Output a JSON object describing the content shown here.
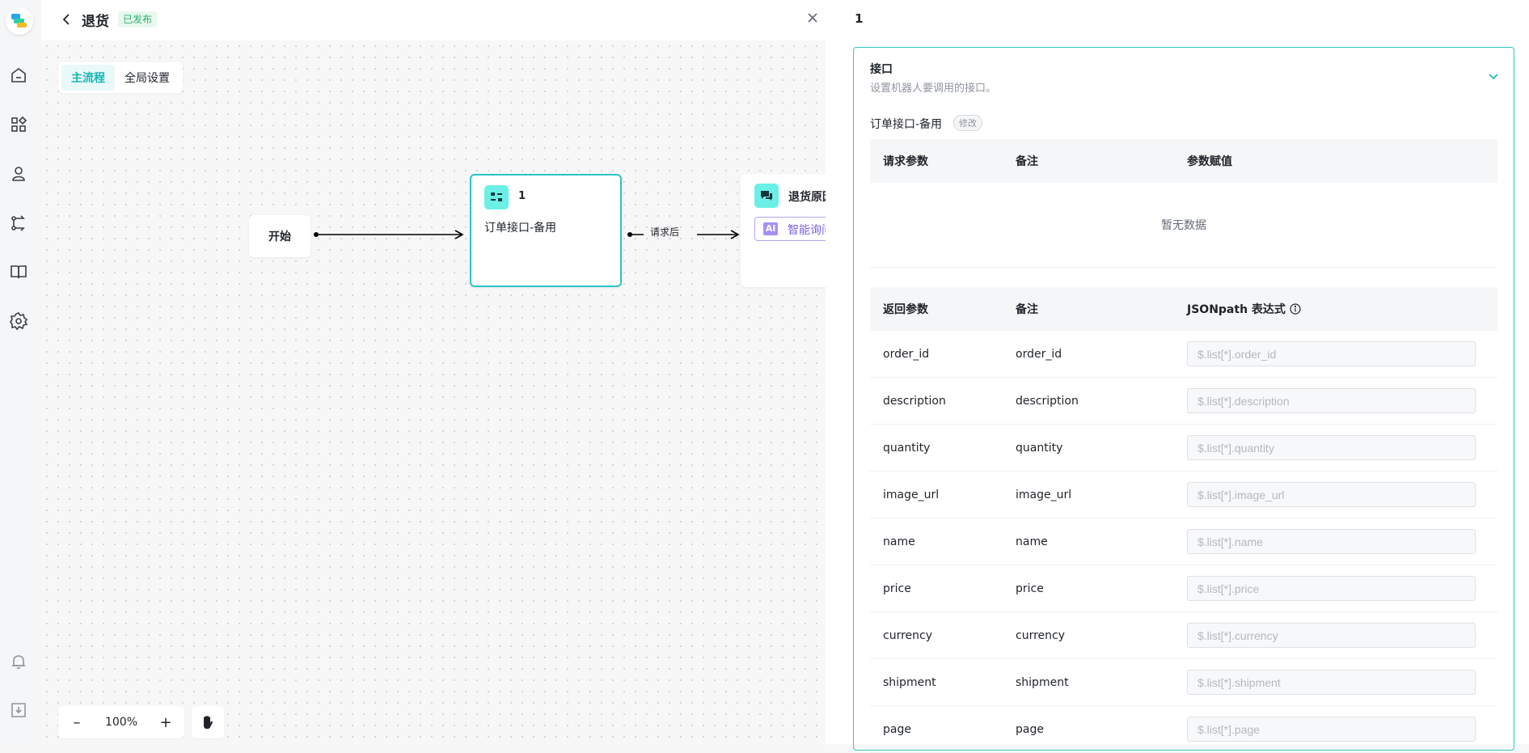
{
  "header": {
    "title": "退货",
    "status": "已发布"
  },
  "canvas": {
    "tabs": [
      "主流程",
      "全局设置"
    ],
    "nodes": {
      "start": "开始",
      "api": {
        "title": "1",
        "subtitle": "订单接口-备用"
      },
      "next": {
        "title": "退货原因",
        "ai_badge": "AI",
        "ai_label": "智能询问"
      }
    },
    "edge_label": "请求后",
    "zoom": {
      "minus": "–",
      "level": "100%",
      "plus": "+"
    }
  },
  "panel": {
    "name": "1",
    "section": {
      "title": "接口",
      "description": "设置机器人要调用的接口。",
      "api_name": "订单接口-备用",
      "edit_label": "修改",
      "request_table": {
        "headers": [
          "请求参数",
          "备注",
          "参数赋值"
        ],
        "empty_text": "暂无数据"
      },
      "response_table": {
        "headers": [
          "返回参数",
          "备注",
          "JSONpath 表达式"
        ],
        "rows": [
          {
            "param": "order_id",
            "note": "order_id",
            "placeholder": "$.list[*].order_id"
          },
          {
            "param": "description",
            "note": "description",
            "placeholder": "$.list[*].description"
          },
          {
            "param": "quantity",
            "note": "quantity",
            "placeholder": "$.list[*].quantity"
          },
          {
            "param": "image_url",
            "note": "image_url",
            "placeholder": "$.list[*].image_url"
          },
          {
            "param": "name",
            "note": "name",
            "placeholder": "$.list[*].name"
          },
          {
            "param": "price",
            "note": "price",
            "placeholder": "$.list[*].price"
          },
          {
            "param": "currency",
            "note": "currency",
            "placeholder": "$.list[*].currency"
          },
          {
            "param": "shipment",
            "note": "shipment",
            "placeholder": "$.list[*].shipment"
          },
          {
            "param": "page",
            "note": "page",
            "placeholder": "$.list[*].page"
          }
        ]
      }
    }
  },
  "colors": {
    "accent": "#18b4b4",
    "node_icon": "#6af0e4",
    "ai": "#7b61e6",
    "published": "#27b26b"
  },
  "icons": {
    "sidebar": [
      "home-icon",
      "apps-icon",
      "robot-icon",
      "flow-icon",
      "book-icon",
      "gear-icon",
      "bell-icon",
      "download-icon"
    ],
    "toolbar": [
      "chevron-left-icon",
      "close-icon",
      "chevron-down-icon",
      "hand-icon",
      "info-icon"
    ]
  }
}
